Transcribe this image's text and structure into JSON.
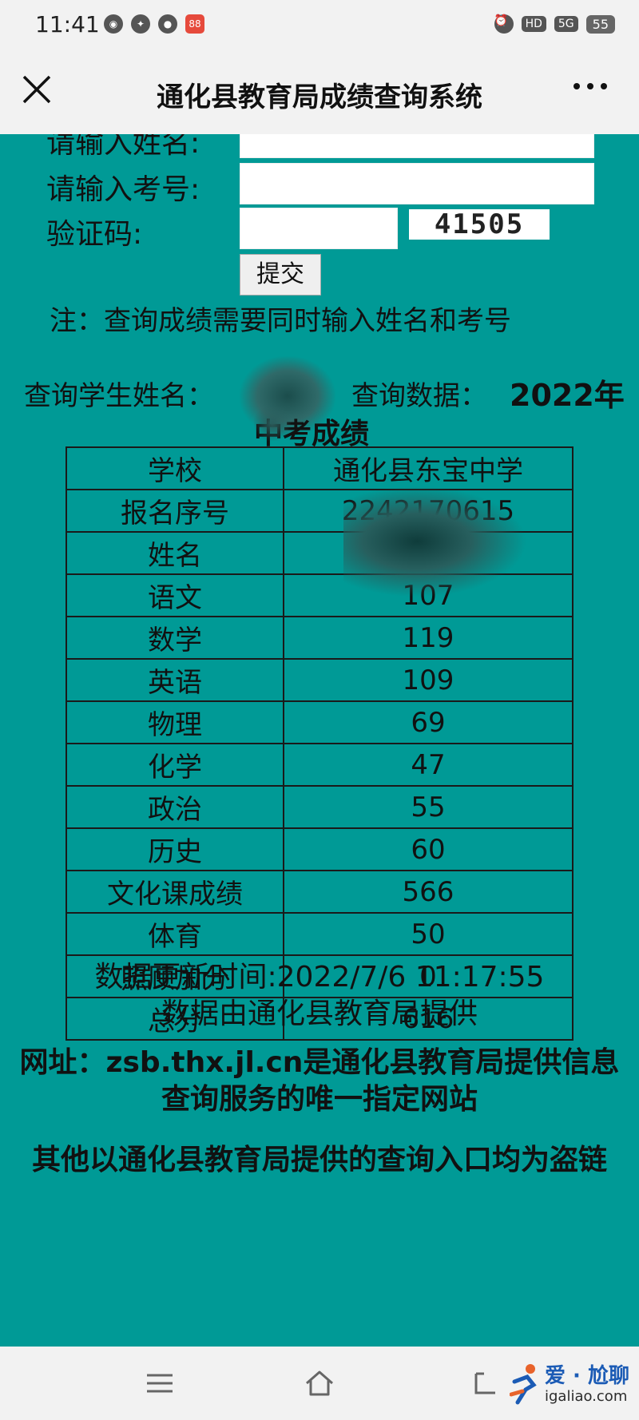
{
  "status_bar": {
    "time": "11:41",
    "net": "HD",
    "signal": "5G",
    "battery": "55",
    "app_badge": "88"
  },
  "title_bar": {
    "title": "通化县教育局成绩查询系统"
  },
  "form": {
    "name_label": "请输入姓名:",
    "exam_no_label": "请输入考号:",
    "captcha_label": "验证码:",
    "captcha_text": "41505",
    "submit_label": "提交",
    "note": "注：查询成绩需要同时输入姓名和考号"
  },
  "query": {
    "student_label": "查询学生姓名：",
    "data_label": "查询数据：",
    "year": "2022年",
    "subtitle": "中考成绩"
  },
  "scores": {
    "rows": [
      {
        "key": "学校",
        "value": "通化县东宝中学"
      },
      {
        "key": "报名序号",
        "value": "2242170615"
      },
      {
        "key": "姓名",
        "value": ""
      },
      {
        "key": "语文",
        "value": "107"
      },
      {
        "key": "数学",
        "value": "119"
      },
      {
        "key": "英语",
        "value": "109"
      },
      {
        "key": "物理",
        "value": "69"
      },
      {
        "key": "化学",
        "value": "47"
      },
      {
        "key": "政治",
        "value": "55"
      },
      {
        "key": "历史",
        "value": "60"
      },
      {
        "key": "文化课成绩",
        "value": "566"
      },
      {
        "key": "体育",
        "value": "50"
      },
      {
        "key": "照顾加分",
        "value": "0"
      },
      {
        "key": "总分",
        "value": "616"
      }
    ]
  },
  "footer": {
    "update_time": "数据更新时间:2022/7/6 11:17:55",
    "provider": "数据由通化县教育局提供",
    "site_notice": "网址：zsb.thx.jl.cn是通化县教育局提供信息查询服务的唯一指定网站",
    "warning": "其他以通化县教育局提供的查询入口均为盗链"
  },
  "watermark": {
    "title": "爱 · 尬聊",
    "url": "igaliao.com"
  },
  "colors": {
    "content_bg": "#009a96",
    "bar_bg": "#f2f2f2"
  }
}
